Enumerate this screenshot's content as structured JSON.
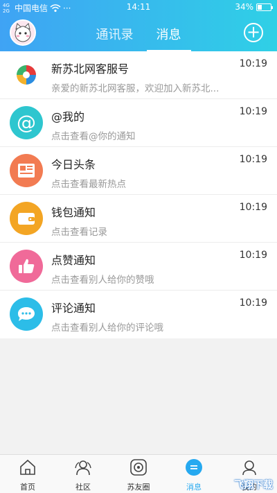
{
  "status_bar": {
    "signal_text": "4G 2G",
    "carrier": "中国电信",
    "dots": "···",
    "time": "14:11",
    "battery": "34%",
    "battery_level": 0.34
  },
  "header": {
    "tabs": [
      {
        "label": "通讯录",
        "active": false
      },
      {
        "label": "消息",
        "active": true
      }
    ],
    "add_icon": "plus-circle-icon",
    "avatar_icon": "cat-avatar-icon"
  },
  "messages": [
    {
      "title": "新苏北网客服号",
      "subtitle": "亲爱的新苏北网客服，欢迎加入新苏北...",
      "time": "10:19",
      "icon": "logo-icon",
      "color": "#ffffff"
    },
    {
      "title": "@我的",
      "subtitle": "点击查看@你的通知",
      "time": "10:19",
      "icon": "at-icon",
      "color": "#2ec6cf"
    },
    {
      "title": "今日头条",
      "subtitle": "点击查看最新热点",
      "time": "10:19",
      "icon": "newspaper-icon",
      "color": "#f27b52"
    },
    {
      "title": "钱包通知",
      "subtitle": "点击查看记录",
      "time": "10:19",
      "icon": "wallet-icon",
      "color": "#f3a524"
    },
    {
      "title": "点赞通知",
      "subtitle": "点击查看别人给你的赞哦",
      "time": "10:19",
      "icon": "thumbs-up-icon",
      "color": "#f06a99"
    },
    {
      "title": "评论通知",
      "subtitle": "点击查看别人给你的评论哦",
      "time": "10:19",
      "icon": "comment-icon",
      "color": "#2cbde8"
    }
  ],
  "bottom_nav": [
    {
      "label": "首页",
      "icon": "home-icon",
      "active": false
    },
    {
      "label": "社区",
      "icon": "community-icon",
      "active": false
    },
    {
      "label": "苏友圈",
      "icon": "circle-icon",
      "active": false
    },
    {
      "label": "消息",
      "icon": "message-icon",
      "active": true
    },
    {
      "label": "我的",
      "icon": "profile-icon",
      "active": false
    }
  ],
  "watermark": "飞翔下载"
}
